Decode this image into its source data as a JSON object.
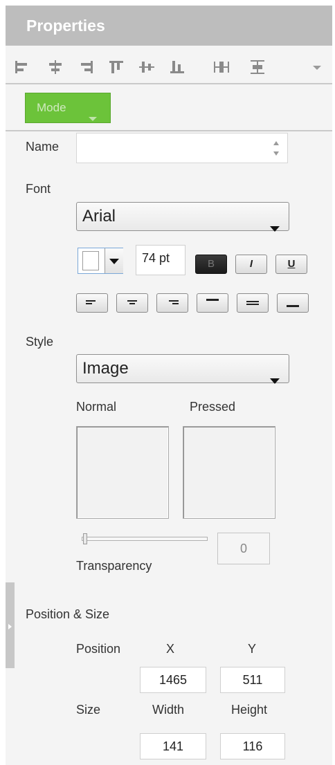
{
  "panel": {
    "title": "Properties"
  },
  "toolbar": {
    "icons": [
      "align-left-icon",
      "align-center-h-icon",
      "align-right-icon",
      "align-top-icon",
      "align-middle-v-icon",
      "align-bottom-icon",
      "distribute-h-icon",
      "distribute-v-icon"
    ],
    "more_icon": "chevron-down-icon"
  },
  "mode": {
    "label": "Mode"
  },
  "name": {
    "label": "Name",
    "value": ""
  },
  "font": {
    "label": "Font",
    "family": "Arial",
    "size": "74 pt",
    "bold_label": "B",
    "italic_label": "I",
    "underline_label": "U",
    "color": "#ffffff"
  },
  "style": {
    "label": "Style",
    "value": "Image",
    "normal_label": "Normal",
    "pressed_label": "Pressed",
    "transparency_label": "Transparency",
    "transparency_value": "0"
  },
  "position_size": {
    "label": "Position & Size",
    "position_label": "Position",
    "size_label": "Size",
    "x_label": "X",
    "y_label": "Y",
    "width_label": "Width",
    "height_label": "Height",
    "x": "1465",
    "y": "511",
    "width": "141",
    "height": "116"
  },
  "colors": {
    "accent": "#6cc33a",
    "header": "#bdbdbd"
  }
}
